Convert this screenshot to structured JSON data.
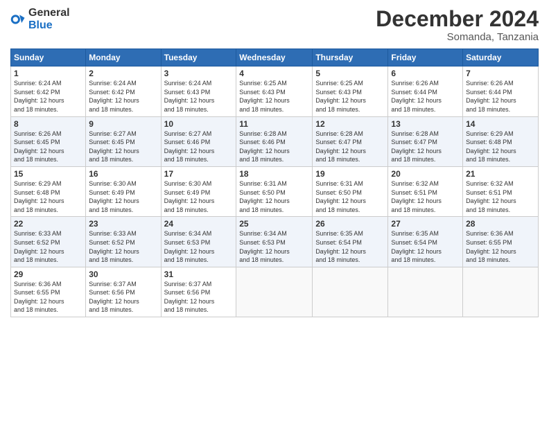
{
  "logo": {
    "text_general": "General",
    "text_blue": "Blue"
  },
  "title": {
    "month_year": "December 2024",
    "location": "Somanda, Tanzania"
  },
  "days_of_week": [
    "Sunday",
    "Monday",
    "Tuesday",
    "Wednesday",
    "Thursday",
    "Friday",
    "Saturday"
  ],
  "weeks": [
    [
      {
        "day": "1",
        "sunrise": "6:24 AM",
        "sunset": "6:42 PM",
        "daylight": "12 hours and 18 minutes."
      },
      {
        "day": "2",
        "sunrise": "6:24 AM",
        "sunset": "6:42 PM",
        "daylight": "12 hours and 18 minutes."
      },
      {
        "day": "3",
        "sunrise": "6:24 AM",
        "sunset": "6:43 PM",
        "daylight": "12 hours and 18 minutes."
      },
      {
        "day": "4",
        "sunrise": "6:25 AM",
        "sunset": "6:43 PM",
        "daylight": "12 hours and 18 minutes."
      },
      {
        "day": "5",
        "sunrise": "6:25 AM",
        "sunset": "6:43 PM",
        "daylight": "12 hours and 18 minutes."
      },
      {
        "day": "6",
        "sunrise": "6:26 AM",
        "sunset": "6:44 PM",
        "daylight": "12 hours and 18 minutes."
      },
      {
        "day": "7",
        "sunrise": "6:26 AM",
        "sunset": "6:44 PM",
        "daylight": "12 hours and 18 minutes."
      }
    ],
    [
      {
        "day": "8",
        "sunrise": "6:26 AM",
        "sunset": "6:45 PM",
        "daylight": "12 hours and 18 minutes."
      },
      {
        "day": "9",
        "sunrise": "6:27 AM",
        "sunset": "6:45 PM",
        "daylight": "12 hours and 18 minutes."
      },
      {
        "day": "10",
        "sunrise": "6:27 AM",
        "sunset": "6:46 PM",
        "daylight": "12 hours and 18 minutes."
      },
      {
        "day": "11",
        "sunrise": "6:28 AM",
        "sunset": "6:46 PM",
        "daylight": "12 hours and 18 minutes."
      },
      {
        "day": "12",
        "sunrise": "6:28 AM",
        "sunset": "6:47 PM",
        "daylight": "12 hours and 18 minutes."
      },
      {
        "day": "13",
        "sunrise": "6:28 AM",
        "sunset": "6:47 PM",
        "daylight": "12 hours and 18 minutes."
      },
      {
        "day": "14",
        "sunrise": "6:29 AM",
        "sunset": "6:48 PM",
        "daylight": "12 hours and 18 minutes."
      }
    ],
    [
      {
        "day": "15",
        "sunrise": "6:29 AM",
        "sunset": "6:48 PM",
        "daylight": "12 hours and 18 minutes."
      },
      {
        "day": "16",
        "sunrise": "6:30 AM",
        "sunset": "6:49 PM",
        "daylight": "12 hours and 18 minutes."
      },
      {
        "day": "17",
        "sunrise": "6:30 AM",
        "sunset": "6:49 PM",
        "daylight": "12 hours and 18 minutes."
      },
      {
        "day": "18",
        "sunrise": "6:31 AM",
        "sunset": "6:50 PM",
        "daylight": "12 hours and 18 minutes."
      },
      {
        "day": "19",
        "sunrise": "6:31 AM",
        "sunset": "6:50 PM",
        "daylight": "12 hours and 18 minutes."
      },
      {
        "day": "20",
        "sunrise": "6:32 AM",
        "sunset": "6:51 PM",
        "daylight": "12 hours and 18 minutes."
      },
      {
        "day": "21",
        "sunrise": "6:32 AM",
        "sunset": "6:51 PM",
        "daylight": "12 hours and 18 minutes."
      }
    ],
    [
      {
        "day": "22",
        "sunrise": "6:33 AM",
        "sunset": "6:52 PM",
        "daylight": "12 hours and 18 minutes."
      },
      {
        "day": "23",
        "sunrise": "6:33 AM",
        "sunset": "6:52 PM",
        "daylight": "12 hours and 18 minutes."
      },
      {
        "day": "24",
        "sunrise": "6:34 AM",
        "sunset": "6:53 PM",
        "daylight": "12 hours and 18 minutes."
      },
      {
        "day": "25",
        "sunrise": "6:34 AM",
        "sunset": "6:53 PM",
        "daylight": "12 hours and 18 minutes."
      },
      {
        "day": "26",
        "sunrise": "6:35 AM",
        "sunset": "6:54 PM",
        "daylight": "12 hours and 18 minutes."
      },
      {
        "day": "27",
        "sunrise": "6:35 AM",
        "sunset": "6:54 PM",
        "daylight": "12 hours and 18 minutes."
      },
      {
        "day": "28",
        "sunrise": "6:36 AM",
        "sunset": "6:55 PM",
        "daylight": "12 hours and 18 minutes."
      }
    ],
    [
      {
        "day": "29",
        "sunrise": "6:36 AM",
        "sunset": "6:55 PM",
        "daylight": "12 hours and 18 minutes."
      },
      {
        "day": "30",
        "sunrise": "6:37 AM",
        "sunset": "6:56 PM",
        "daylight": "12 hours and 18 minutes."
      },
      {
        "day": "31",
        "sunrise": "6:37 AM",
        "sunset": "6:56 PM",
        "daylight": "12 hours and 18 minutes."
      },
      null,
      null,
      null,
      null
    ]
  ],
  "labels": {
    "sunrise": "Sunrise:",
    "sunset": "Sunset:",
    "daylight": "Daylight:"
  }
}
